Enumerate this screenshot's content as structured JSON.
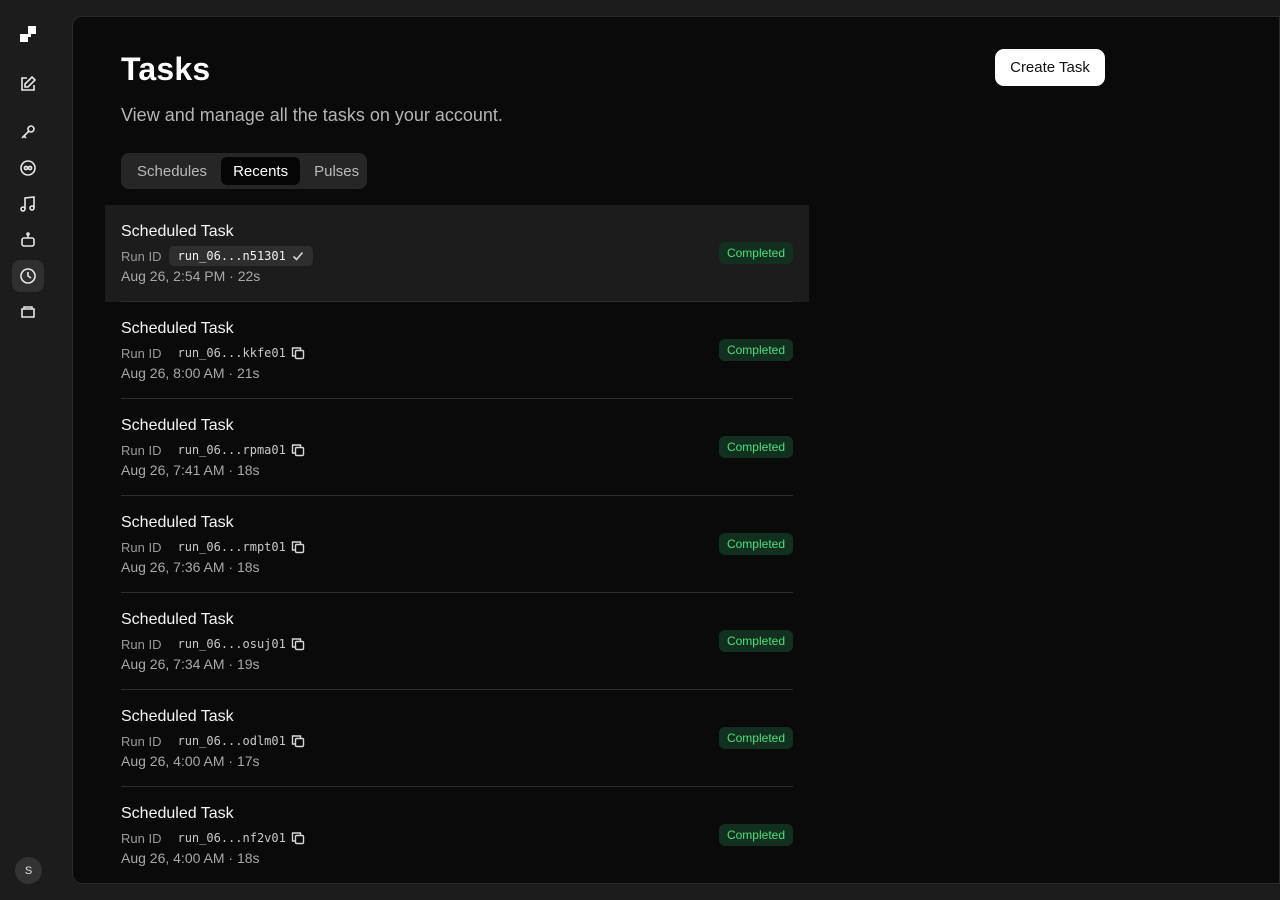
{
  "sidebar": {
    "icons": [
      "logo-icon",
      "compose-icon",
      "key-icon",
      "connector-icon",
      "music-icon",
      "bot-icon",
      "clock-icon",
      "folder-icon"
    ],
    "active": "clock-icon",
    "avatar_initial": "S"
  },
  "header": {
    "title": "Tasks",
    "subtitle": "View and manage all the tasks on your account.",
    "create_label": "Create Task"
  },
  "tabs": [
    {
      "label": "Schedules",
      "active": false
    },
    {
      "label": "Recents",
      "active": true
    },
    {
      "label": "Pulses",
      "active": false
    }
  ],
  "run_id_label": "Run ID",
  "tasks": [
    {
      "title": "Scheduled Task",
      "run_id": "run_06...n51301",
      "meta": "Aug 26, 2:54 PM · 22s",
      "status": "Completed",
      "copied": true
    },
    {
      "title": "Scheduled Task",
      "run_id": "run_06...kkfe01",
      "meta": "Aug 26, 8:00 AM · 21s",
      "status": "Completed",
      "copied": false
    },
    {
      "title": "Scheduled Task",
      "run_id": "run_06...rpma01",
      "meta": "Aug 26, 7:41 AM · 18s",
      "status": "Completed",
      "copied": false
    },
    {
      "title": "Scheduled Task",
      "run_id": "run_06...rmpt01",
      "meta": "Aug 26, 7:36 AM · 18s",
      "status": "Completed",
      "copied": false
    },
    {
      "title": "Scheduled Task",
      "run_id": "run_06...osuj01",
      "meta": "Aug 26, 7:34 AM · 19s",
      "status": "Completed",
      "copied": false
    },
    {
      "title": "Scheduled Task",
      "run_id": "run_06...odlm01",
      "meta": "Aug 26, 4:00 AM · 17s",
      "status": "Completed",
      "copied": false
    },
    {
      "title": "Scheduled Task",
      "run_id": "run_06...nf2v01",
      "meta": "Aug 26, 4:00 AM · 18s",
      "status": "Completed",
      "copied": false
    }
  ],
  "colors": {
    "background": "#0a0a0a",
    "status_text": "#4ade80",
    "status_bg": "#12301f"
  }
}
